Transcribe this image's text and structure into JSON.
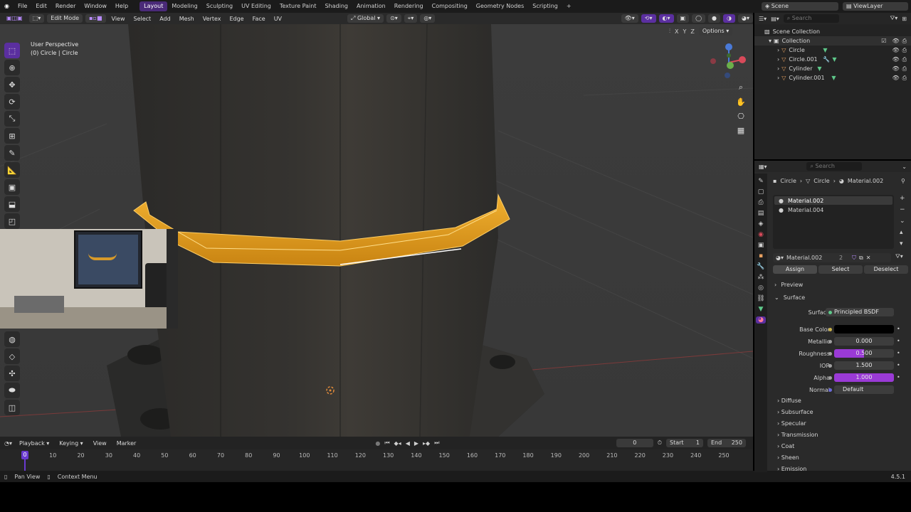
{
  "topbar": {
    "menus": [
      "File",
      "Edit",
      "Render",
      "Window",
      "Help"
    ],
    "workspaces": [
      "Layout",
      "Modeling",
      "Sculpting",
      "UV Editing",
      "Texture Paint",
      "Shading",
      "Animation",
      "Rendering",
      "Compositing",
      "Geometry Nodes",
      "Scripting"
    ],
    "active_workspace": "Layout",
    "scene": "Scene",
    "view_layer": "ViewLayer"
  },
  "viewport_header": {
    "mode": "Edit Mode",
    "menus": [
      "View",
      "Select",
      "Add",
      "Mesh",
      "Vertex",
      "Edge",
      "Face",
      "UV"
    ],
    "orientation": "Global",
    "axes": [
      "X",
      "Y",
      "Z"
    ],
    "options": "Options"
  },
  "viewport": {
    "perspective": "User Perspective",
    "object_info": "(0) Circle | Circle",
    "accent": "#e6a21e"
  },
  "timeline": {
    "menus": [
      "Playback",
      "Keying",
      "View",
      "Marker"
    ],
    "current_frame": "0",
    "start_label": "Start",
    "start": "1",
    "end_label": "End",
    "end": "250",
    "ticks": [
      "0",
      "10",
      "20",
      "30",
      "40",
      "50",
      "60",
      "70",
      "80",
      "90",
      "100",
      "110",
      "120",
      "130",
      "140",
      "150",
      "160",
      "170",
      "180",
      "190",
      "200",
      "210",
      "220",
      "230",
      "240",
      "250"
    ]
  },
  "statusbar": {
    "hint1": "Pan View",
    "hint2": "Context Menu",
    "version": "4.5.1"
  },
  "outliner": {
    "search_placeholder": "Search",
    "root": "Scene Collection",
    "collection": "Collection",
    "objects": [
      "Circle",
      "Circle.001",
      "Cylinder",
      "Cylinder.001"
    ]
  },
  "properties": {
    "search_placeholder": "Search",
    "breadcrumb": [
      "Circle",
      "Circle",
      "Material.002"
    ],
    "material_slots": [
      "Material.002",
      "Material.004"
    ],
    "material_name": "Material.002",
    "user_count": "2",
    "buttons": {
      "assign": "Assign",
      "select": "Select",
      "deselect": "Deselect"
    },
    "panels": {
      "preview": "Preview",
      "surface": "Surface"
    },
    "surface": {
      "surface_label": "Surface",
      "shader": "Principled BSDF",
      "base_color_label": "Base Color",
      "base_color": "#000000",
      "metallic_label": "Metallic",
      "metallic": "0.000",
      "roughness_label": "Roughness",
      "roughness": "0.500",
      "roughness_fraction": 0.5,
      "ior_label": "IOR",
      "ior": "1.500",
      "alpha_label": "Alpha",
      "alpha": "1.000",
      "alpha_fraction": 1.0,
      "normal_label": "Normal",
      "normal": "Default"
    },
    "subpanels": [
      "Diffuse",
      "Subsurface",
      "Specular",
      "Transmission",
      "Coat",
      "Sheen",
      "Emission"
    ]
  }
}
